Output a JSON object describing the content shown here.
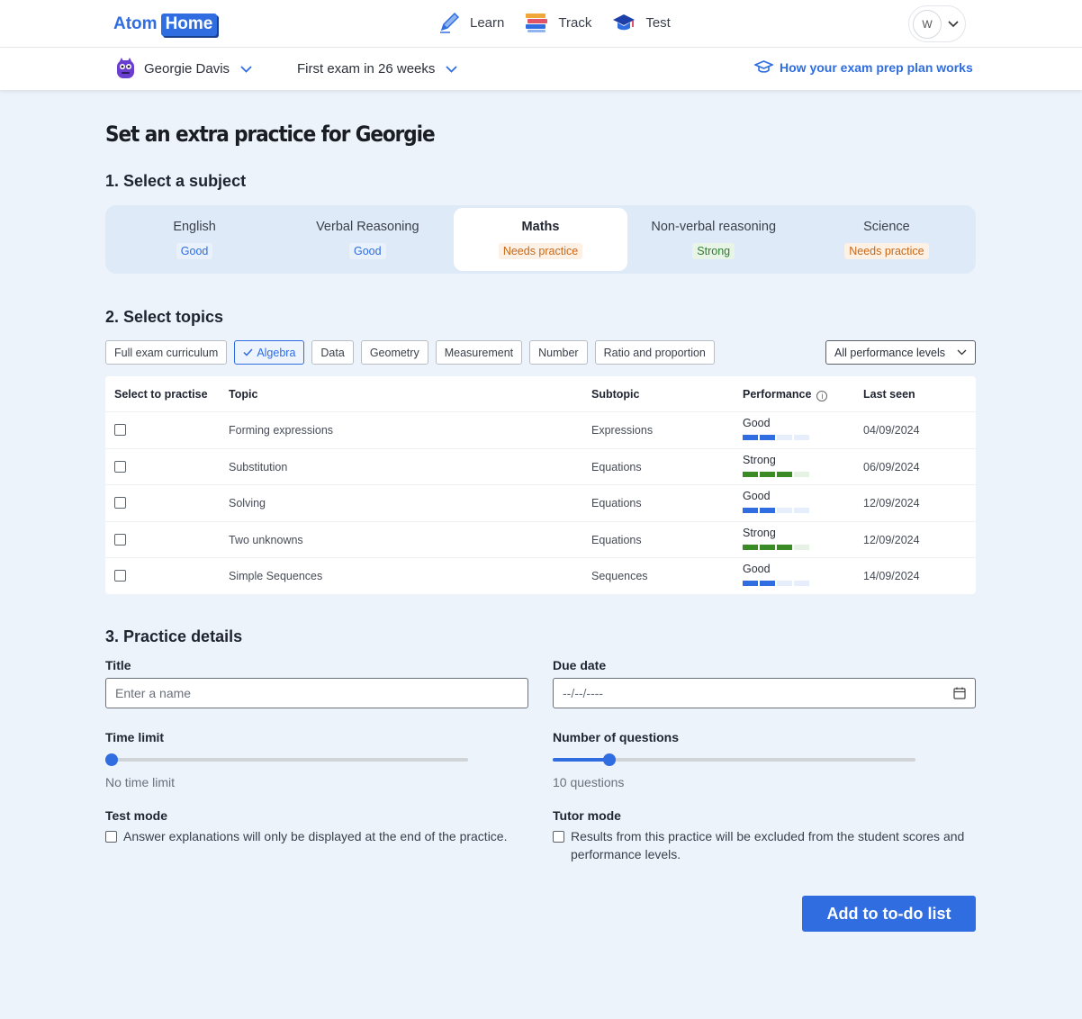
{
  "brand": {
    "logo_left": "Atom",
    "logo_right": "Home"
  },
  "nav": [
    {
      "label": "Learn",
      "icon": "pencil-icon"
    },
    {
      "label": "Track",
      "icon": "books-icon"
    },
    {
      "label": "Test",
      "icon": "graduation-cap-icon"
    }
  ],
  "user": {
    "initial": "W"
  },
  "subnav": {
    "student_name": "Georgie Davis",
    "exam_info": "First exam in 26 weeks",
    "help_link": "How your exam prep plan works"
  },
  "page": {
    "title": "Set an extra practice for Georgie"
  },
  "section1": {
    "heading": "1. Select a subject",
    "subjects": [
      {
        "name": "English",
        "level": "Good",
        "level_type": "good"
      },
      {
        "name": "Verbal Reasoning",
        "level": "Good",
        "level_type": "good"
      },
      {
        "name": "Maths",
        "level": "Needs practice",
        "level_type": "needs"
      },
      {
        "name": "Non-verbal reasoning",
        "level": "Strong",
        "level_type": "strong"
      },
      {
        "name": "Science",
        "level": "Needs practice",
        "level_type": "needs"
      }
    ],
    "selected_subject": "Maths"
  },
  "section2": {
    "heading": "2. Select topics",
    "chips": [
      "Full exam curriculum",
      "Algebra",
      "Data",
      "Geometry",
      "Measurement",
      "Number",
      "Ratio and proportion"
    ],
    "selected_chip": "Algebra",
    "filter_value": "All performance levels",
    "columns": [
      "Select to practise",
      "Topic",
      "Subtopic",
      "Performance",
      "Last seen"
    ],
    "rows": [
      {
        "topic": "Forming expressions",
        "subtopic": "Expressions",
        "performance": "Good",
        "performance_segments": 2,
        "last_seen": "04/09/2024"
      },
      {
        "topic": "Substitution",
        "subtopic": "Equations",
        "performance": "Strong",
        "performance_segments": 3,
        "last_seen": "06/09/2024"
      },
      {
        "topic": "Solving",
        "subtopic": "Equations",
        "performance": "Good",
        "performance_segments": 2,
        "last_seen": "12/09/2024"
      },
      {
        "topic": "Two unknowns",
        "subtopic": "Equations",
        "performance": "Strong",
        "performance_segments": 3,
        "last_seen": "12/09/2024"
      },
      {
        "topic": "Simple Sequences",
        "subtopic": "Sequences",
        "performance": "Good",
        "performance_segments": 2,
        "last_seen": "14/09/2024"
      }
    ]
  },
  "section3": {
    "heading": "3. Practice details",
    "title_label": "Title",
    "title_placeholder": "Enter a name",
    "due_label": "Due date",
    "due_placeholder": "--/--/----",
    "time_label": "Time limit",
    "time_value_text": "No time limit",
    "time_slider_fraction": 0,
    "questions_label": "Number of questions",
    "questions_value_text": "10 questions",
    "questions_slider_fraction": 0.14,
    "test_mode_label": "Test mode",
    "test_mode_text": "Answer explanations will only be displayed at the end of the practice.",
    "tutor_mode_label": "Tutor mode",
    "tutor_mode_text": "Results from this practice will be excluded from the student scores and performance levels."
  },
  "actions": {
    "submit": "Add to to-do list"
  },
  "colors": {
    "accent": "#2f6de1",
    "good": "#2f6de1",
    "needs_practice": "#c7691a",
    "strong": "#3a8b25",
    "page_bg": "#edf3fb"
  }
}
